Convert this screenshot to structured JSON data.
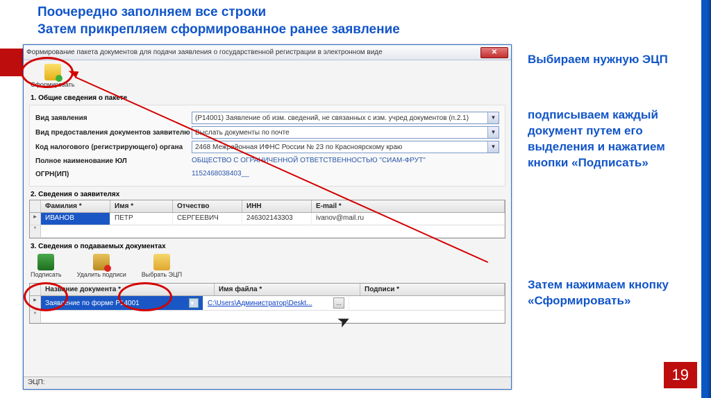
{
  "instruction": {
    "line1": "Поочередно заполняем все строки",
    "line2": "Затем прикрепляем сформированное ранее заявление"
  },
  "side": {
    "choose": "Выбираем нужную ЭЦП",
    "sign": "подписываем каждый документ путем его выделения и нажатием кнопки «Подписать»",
    "form": "Затем нажимаем кнопку «Сформировать»"
  },
  "page_number": "19",
  "window": {
    "title": "Формирование пакета документов для подачи заявления о государственной регистрации в электронном виде",
    "close": "✕",
    "btn_form": "Сформировать",
    "section1_title": "1. Общие сведения о пакете",
    "fields": {
      "app_type_label": "Вид заявления",
      "app_type_value": "(Р14001) Заявление об изм. сведений, не связанных с изм. учред документов (п.2.1)",
      "delivery_label": "Вид предоставления документов заявителю",
      "delivery_value": "Выслать документы по почте",
      "tax_code_label": "Код налогового (регистрирующего) органа",
      "tax_code_value": "2468 Межрайонная ИФНС России № 23 по Красноярскому краю",
      "full_name_label": "Полное наименование ЮЛ",
      "full_name_value": "ОБЩЕСТВО С ОГРАНИЧЕННОЙ ОТВЕТСТВЕННОСТЬЮ \"СИАМ-ФРУТ\"",
      "ogrn_label": "ОГРН(ИП)",
      "ogrn_value": "1152468038403__"
    },
    "section2_title": "2. Сведения о заявителях",
    "grid1": {
      "headers": {
        "fam": "Фамилия *",
        "name": "Имя *",
        "otch": "Отчество",
        "inn": "ИНН",
        "email": "E-mail *"
      },
      "row": {
        "fam": "ИВАНОВ",
        "name": "ПЕТР",
        "otch": "СЕРГЕЕВИЧ",
        "inn": "246302143303",
        "email": "ivanov@mail.ru"
      }
    },
    "section3_title": "3. Сведения о подаваемых документах",
    "btn_sign": "Подписать",
    "btn_delete": "Удалить подписи",
    "btn_select": "Выбрать ЭЦП",
    "grid2": {
      "headers": {
        "doc": "Название документа *",
        "file": "Имя файла *",
        "sig": "Подписи *"
      },
      "row": {
        "doc": "Заявление по форме Р14001",
        "file": "C:\\Users\\Администратор\\Deskt..."
      }
    },
    "status_label": "ЭЦП:"
  }
}
